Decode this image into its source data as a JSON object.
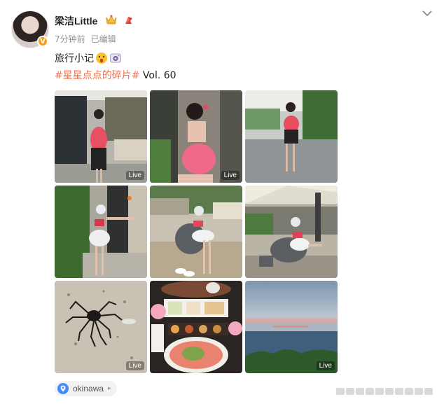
{
  "post": {
    "username": "梁洁Little",
    "time": "7分钟前",
    "edited": "已编辑",
    "text_line1": "旅行小记",
    "hashtag": "#星星点点的碎片#",
    "vol": " Vol. 60",
    "live_label": "Live",
    "location": "okinawa"
  },
  "colors": {
    "hashtag": "#eb7350",
    "meta": "#939393",
    "verified": "#f89b1c"
  },
  "icons": [
    "chevron-down-icon",
    "verified-badge-icon",
    "crown-badge-icon",
    "sticker-badge-icon",
    "surprised-emoji-icon",
    "camera-emoji-icon",
    "location-pin-icon"
  ],
  "images": [
    {
      "name": "photo-1",
      "live": true
    },
    {
      "name": "photo-2",
      "live": true
    },
    {
      "name": "photo-3",
      "live": false
    },
    {
      "name": "photo-4",
      "live": false
    },
    {
      "name": "photo-5",
      "live": false
    },
    {
      "name": "photo-6",
      "live": false
    },
    {
      "name": "photo-7",
      "live": true
    },
    {
      "name": "photo-8",
      "live": false
    },
    {
      "name": "photo-9",
      "live": true
    }
  ]
}
